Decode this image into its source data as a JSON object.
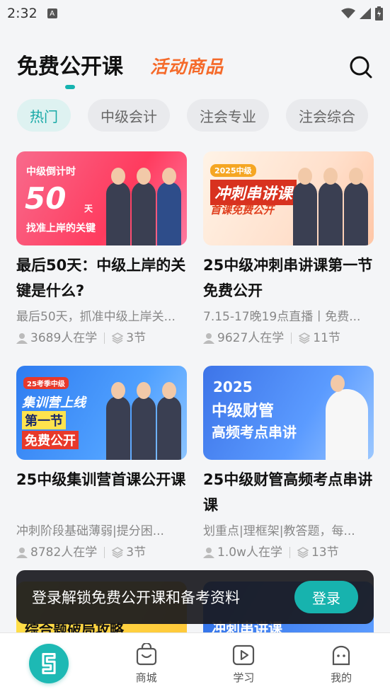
{
  "status_bar": {
    "time": "2:32",
    "notif_glyph": "A"
  },
  "header": {
    "main_tab": "免费公开课",
    "activity_tab": "活动商品",
    "accent": "#15b3b0",
    "activity_color": "#f56a2a"
  },
  "chips": [
    {
      "label": "热门",
      "active": true
    },
    {
      "label": "中级会计",
      "active": false
    },
    {
      "label": "注会专业",
      "active": false
    },
    {
      "label": "注会综合",
      "active": false
    }
  ],
  "courses": [
    {
      "thumb": {
        "line1": "中级倒计时",
        "line2": "50",
        "line2_suffix": "天",
        "line3": "找准上岸的关键"
      },
      "title": "最后50天：中级上岸的关键是什么?",
      "desc": "最后50天，抓准中级上岸关...",
      "learners": "3689人在学",
      "lessons": "3节"
    },
    {
      "thumb": {
        "line1": "2025中级",
        "line2": "冲刺串讲课",
        "line3": "首课免费公开"
      },
      "title": "25中级冲刺串讲课第一节免费公开",
      "desc": "7.15-17晚19点直播丨免费...",
      "learners": "9627人在学",
      "lessons": "11节"
    },
    {
      "thumb": {
        "line1": "25考季中级",
        "line2": "集训营上线",
        "line3": "第一节",
        "line4": "免费公开"
      },
      "title": "25中级集训营首课公开课",
      "desc": "冲刺阶段基础薄弱|提分困...",
      "learners": "8782人在学",
      "lessons": "3节"
    },
    {
      "thumb": {
        "line1": "2025",
        "line2": "中级财管",
        "line3": "高频考点串讲"
      },
      "title": "25中级财管高频考点串讲课",
      "desc": "划重点|理框架|教答题，每...",
      "learners": "1.0w人在学",
      "lessons": "13节"
    }
  ],
  "row3": [
    {
      "line1": "综合题破局攻略"
    },
    {
      "line1": "冲刺串讲课"
    }
  ],
  "login_banner": {
    "text": "登录解锁免费公开课和备考资料",
    "button": "登录"
  },
  "bottom_nav": [
    {
      "label": "",
      "icon": "home-logo-icon"
    },
    {
      "label": "商城",
      "icon": "shopping-bag-icon"
    },
    {
      "label": "学习",
      "icon": "play-icon"
    },
    {
      "label": "我的",
      "icon": "profile-icon"
    }
  ]
}
